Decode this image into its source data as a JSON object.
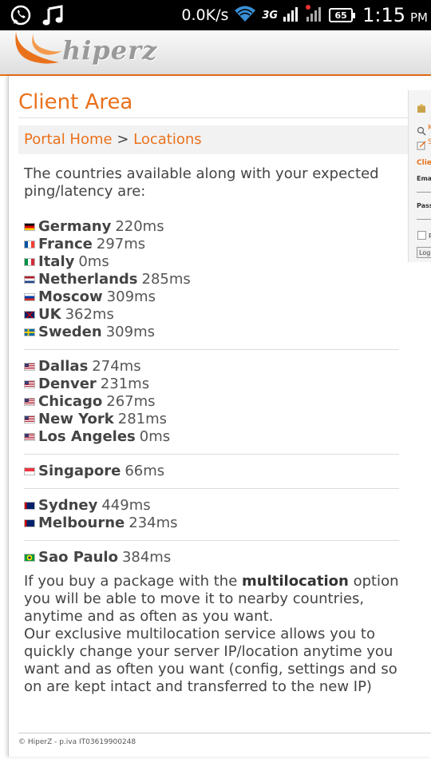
{
  "status_bar": {
    "speed": "0.0K/s",
    "network": "3G",
    "battery": "65",
    "time": "1:15",
    "ampm": "PM"
  },
  "header": {
    "logo_text": "hiperz",
    "accent_color": "#e9711c"
  },
  "page": {
    "title": "Client Area",
    "breadcrumb": {
      "home": "Portal Home",
      "separator": ">",
      "current": "Locations"
    },
    "intro": "The countries available along with your expected ping/latency are:",
    "groups": [
      [
        {
          "flag": "de",
          "country": "Germany",
          "ping": "220ms"
        },
        {
          "flag": "fr",
          "country": "France",
          "ping": "297ms"
        },
        {
          "flag": "it",
          "country": "Italy",
          "ping": "0ms"
        },
        {
          "flag": "nl",
          "country": "Netherlands",
          "ping": "285ms"
        },
        {
          "flag": "ru",
          "country": "Moscow",
          "ping": "309ms"
        },
        {
          "flag": "gb",
          "country": "UK",
          "ping": "362ms"
        },
        {
          "flag": "se",
          "country": "Sweden",
          "ping": "309ms"
        }
      ],
      [
        {
          "flag": "us",
          "country": "Dallas",
          "ping": "274ms"
        },
        {
          "flag": "us",
          "country": "Denver",
          "ping": "231ms"
        },
        {
          "flag": "us",
          "country": "Chicago",
          "ping": "267ms"
        },
        {
          "flag": "us",
          "country": "New York",
          "ping": "281ms"
        },
        {
          "flag": "us",
          "country": "Los Angeles",
          "ping": "0ms"
        }
      ],
      [
        {
          "flag": "sg",
          "country": "Singapore",
          "ping": "66ms"
        }
      ],
      [
        {
          "flag": "au",
          "country": "Sydney",
          "ping": "449ms"
        },
        {
          "flag": "au",
          "country": "Melbourne",
          "ping": "234ms"
        }
      ],
      [
        {
          "flag": "br",
          "country": "Sao Paulo",
          "ping": "384ms"
        }
      ]
    ],
    "para1_before": "If you buy a package with the ",
    "para1_bold": "multilocation",
    "para1_after": " option you will be able to move it to nearby countries, anytime and as often as you want.",
    "para2": "Our exclusive multilocation service allows you to quickly change your server IP/location anytime you want and as often you want (config, settings and so on are kept intact and transferred to the new IP)",
    "footer": "© HiperZ - p.iva IT03619900248"
  },
  "sidebar": {
    "link1": "K",
    "link2": "S",
    "heading": "Clie",
    "email_label": "Emai",
    "password_label": "Pass",
    "remember_label": "R",
    "login_button": "Log"
  }
}
